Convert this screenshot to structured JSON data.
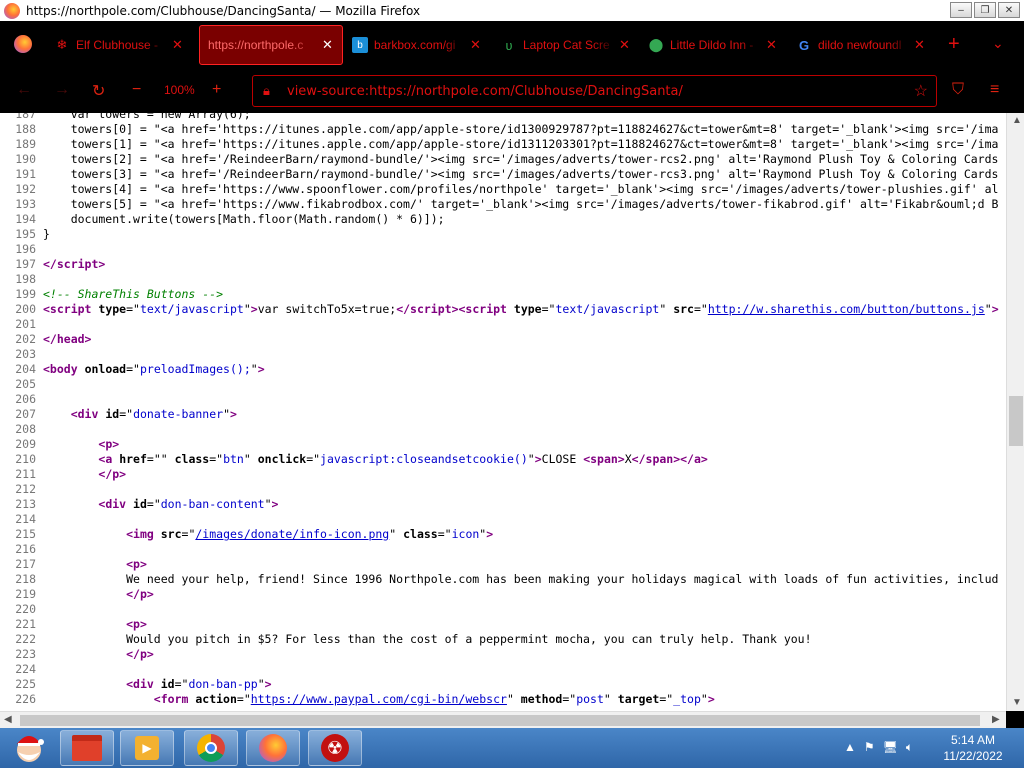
{
  "window": {
    "title": "https://northpole.com/Clubhouse/DancingSanta/ — Mozilla Firefox"
  },
  "tabs": [
    {
      "label": "Elf Clubhouse -",
      "icon": "snowflake-icon",
      "active": false
    },
    {
      "label": "https://northpole.c",
      "icon": "none",
      "active": true
    },
    {
      "label": "barkbox.com/gi",
      "icon": "barkbox-icon",
      "active": false
    },
    {
      "label": "Laptop Cat Scre",
      "icon": "sprout-icon",
      "active": false
    },
    {
      "label": "Little Dildo Inn -",
      "icon": "map-pin-icon",
      "active": false
    },
    {
      "label": "dildo newfoundl",
      "icon": "google-icon",
      "active": false
    }
  ],
  "nav": {
    "zoom": "100%",
    "url": "view-source:https://northpole.com/Clubhouse/DancingSanta/"
  },
  "source_lines": [
    {
      "n": "187",
      "html": "    var towers = new Array(6);"
    },
    {
      "n": "188",
      "html": "    towers[0] = \"&lt;a href='https://itunes.apple.com/app/apple-store/id1300929787?pt=118824627&amp;ct=tower&amp;mt=8' target='_blank'&gt;&lt;img src='/ima"
    },
    {
      "n": "189",
      "html": "    towers[1] = \"&lt;a href='https://itunes.apple.com/app/apple-store/id1311203301?pt=118824627&amp;ct=tower&amp;mt=8' target='_blank'&gt;&lt;img src='/ima"
    },
    {
      "n": "190",
      "html": "    towers[2] = \"&lt;a href='/ReindeerBarn/raymond-bundle/'&gt;&lt;img src='/images/adverts/tower-rcs2.png' alt='Raymond Plush Toy &amp; Coloring Cards"
    },
    {
      "n": "191",
      "html": "    towers[3] = \"&lt;a href='/ReindeerBarn/raymond-bundle/'&gt;&lt;img src='/images/adverts/tower-rcs3.png' alt='Raymond Plush Toy &amp; Coloring Cards"
    },
    {
      "n": "192",
      "html": "    towers[4] = \"&lt;a href='https://www.spoonflower.com/profiles/northpole' target='_blank'&gt;&lt;img src='/images/adverts/tower-plushies.gif' al"
    },
    {
      "n": "193",
      "html": "    towers[5] = \"&lt;a href='https://www.fikabrodbox.com/' target='_blank'&gt;&lt;img src='/images/adverts/tower-fikabrod.gif' alt='Fikabr&amp;ouml;d B"
    },
    {
      "n": "194",
      "html": "    document.write(towers[Math.floor(Math.random() * 6)]);"
    },
    {
      "n": "195",
      "html": "}"
    },
    {
      "n": "196",
      "html": ""
    },
    {
      "n": "197",
      "html": "<span class='t'>&lt;/script&gt;</span>"
    },
    {
      "n": "198",
      "html": ""
    },
    {
      "n": "199",
      "html": "<span class='c'>&lt;!-- ShareThis Buttons --&gt;</span>"
    },
    {
      "n": "200",
      "html": "<span class='t'>&lt;script</span> <span class='a'>type</span>=\"<span class='v'>text/javascript</span>\"<span class='t'>&gt;</span>var switchTo5x=true;<span class='t'>&lt;/script&gt;&lt;script</span> <span class='a'>type</span>=\"<span class='v'>text/javascript</span>\" <span class='a'>src</span>=\"<span class='lk'>http://w.sharethis.com/button/buttons.js</span>\"<span class='t'>&gt;</span>"
    },
    {
      "n": "201",
      "html": ""
    },
    {
      "n": "202",
      "html": "<span class='t'>&lt;/head&gt;</span>"
    },
    {
      "n": "203",
      "html": ""
    },
    {
      "n": "204",
      "html": "<span class='t'>&lt;body</span> <span class='a'>onload</span>=\"<span class='v'>preloadImages();</span>\"<span class='t'>&gt;</span>"
    },
    {
      "n": "205",
      "html": ""
    },
    {
      "n": "206",
      "html": ""
    },
    {
      "n": "207",
      "html": "    <span class='t'>&lt;div</span> <span class='a'>id</span>=\"<span class='v'>donate-banner</span>\"<span class='t'>&gt;</span>"
    },
    {
      "n": "208",
      "html": ""
    },
    {
      "n": "209",
      "html": "        <span class='t'>&lt;p&gt;</span>"
    },
    {
      "n": "210",
      "html": "        <span class='t'>&lt;a</span> <span class='a'>href</span>=\"\" <span class='a'>class</span>=\"<span class='v'>btn</span>\" <span class='a'>onclick</span>=\"<span class='v'>javascript:closeandsetcookie()</span>\"<span class='t'>&gt;</span>CLOSE <span class='t'>&lt;span&gt;</span>X<span class='t'>&lt;/span&gt;&lt;/a&gt;</span>"
    },
    {
      "n": "211",
      "html": "        <span class='t'>&lt;/p&gt;</span>"
    },
    {
      "n": "212",
      "html": ""
    },
    {
      "n": "213",
      "html": "        <span class='t'>&lt;div</span> <span class='a'>id</span>=\"<span class='v'>don-ban-content</span>\"<span class='t'>&gt;</span>"
    },
    {
      "n": "214",
      "html": ""
    },
    {
      "n": "215",
      "html": "            <span class='t'>&lt;img</span> <span class='a'>src</span>=\"<span class='lk'>/images/donate/info-icon.png</span>\" <span class='a'>class</span>=\"<span class='v'>icon</span>\"<span class='t'>&gt;</span>"
    },
    {
      "n": "216",
      "html": ""
    },
    {
      "n": "217",
      "html": "            <span class='t'>&lt;p&gt;</span>"
    },
    {
      "n": "218",
      "html": "            We need your help, friend! Since 1996 Northpole.com has been making your holidays magical with loads of fun activities, includ"
    },
    {
      "n": "219",
      "html": "            <span class='t'>&lt;/p&gt;</span>"
    },
    {
      "n": "220",
      "html": ""
    },
    {
      "n": "221",
      "html": "            <span class='t'>&lt;p&gt;</span>"
    },
    {
      "n": "222",
      "html": "            Would you pitch in $5? For less than the cost of a peppermint mocha, you can truly help. Thank you!"
    },
    {
      "n": "223",
      "html": "            <span class='t'>&lt;/p&gt;</span>"
    },
    {
      "n": "224",
      "html": ""
    },
    {
      "n": "225",
      "html": "            <span class='t'>&lt;div</span> <span class='a'>id</span>=\"<span class='v'>don-ban-pp</span>\"<span class='t'>&gt;</span>"
    },
    {
      "n": "226",
      "html": "                <span class='t'>&lt;form</span> <span class='a'>action</span>=\"<span class='lk'>https://www.paypal.com/cgi-bin/webscr</span>\" <span class='a'>method</span>=\"<span class='v'>post</span>\" <span class='a'>target</span>=\"<span class='v'>_top</span>\"<span class='t'>&gt;</span>"
    }
  ],
  "taskbar": {
    "items": [
      "santa-start-icon",
      "file-manager-icon",
      "media-player-icon",
      "chrome-icon",
      "firefox-icon",
      "radiation-icon"
    ],
    "time": "5:14 AM",
    "date": "11/22/2022"
  }
}
